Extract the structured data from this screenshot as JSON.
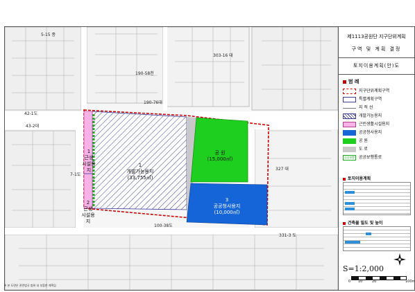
{
  "panel": {
    "title_line1": "제1113공원단 지구단위계획",
    "title_line2": "구역 및 계획 결정",
    "subtitle": "토지이용계획(안)도",
    "legend_heading": "범 례",
    "legend": [
      {
        "label": "지구단위계획구역"
      },
      {
        "label": "특별계획구역"
      },
      {
        "label": "지 적 선"
      },
      {
        "label": "개발가능용지"
      },
      {
        "label": "근린생활시설용지"
      },
      {
        "label": "공공청사용지"
      },
      {
        "label": "공 원"
      },
      {
        "label": "도 로"
      },
      {
        "label": "공공보행통로",
        "badge": "공공보행"
      }
    ],
    "table1_heading": "토지이용계획",
    "table2_heading": "건축물 밀도 및 높이",
    "scale": "S=1:2,000",
    "scale_ticks": [
      "0",
      "10",
      "20",
      "100m"
    ]
  },
  "map": {
    "labels": [
      "5-15 종",
      "303-16 대",
      "190-58천",
      "190-76대",
      "42-1도",
      "43-2대",
      "7-1도",
      "327 대",
      "100-38도",
      "331-3 도"
    ]
  },
  "zones": {
    "facility1": {
      "num": "1",
      "line1": "근생",
      "line2": "시설용지"
    },
    "facility2": {
      "num": "2",
      "line1": "근생",
      "line2": "시설용지"
    },
    "development": {
      "num": "1",
      "name": "개발가능용지",
      "area": "(33,755㎡)"
    },
    "park": {
      "name": "공 원",
      "area": "(15,000㎡)"
    },
    "public_office": {
      "num": "3",
      "name": "공공청사용지",
      "area": "(10,000㎡)"
    }
  },
  "footnote": "※ 본 도면은 관련법규 범위 내 부합한 계획임",
  "colors": {
    "boundary": "#d00000",
    "development": "#3b3b9b",
    "facility": "#f7b3e8",
    "park": "#1fcf1f",
    "public_office": "#1565d8",
    "road": "#c8c8c8",
    "pedestrian": "#22aa22"
  }
}
